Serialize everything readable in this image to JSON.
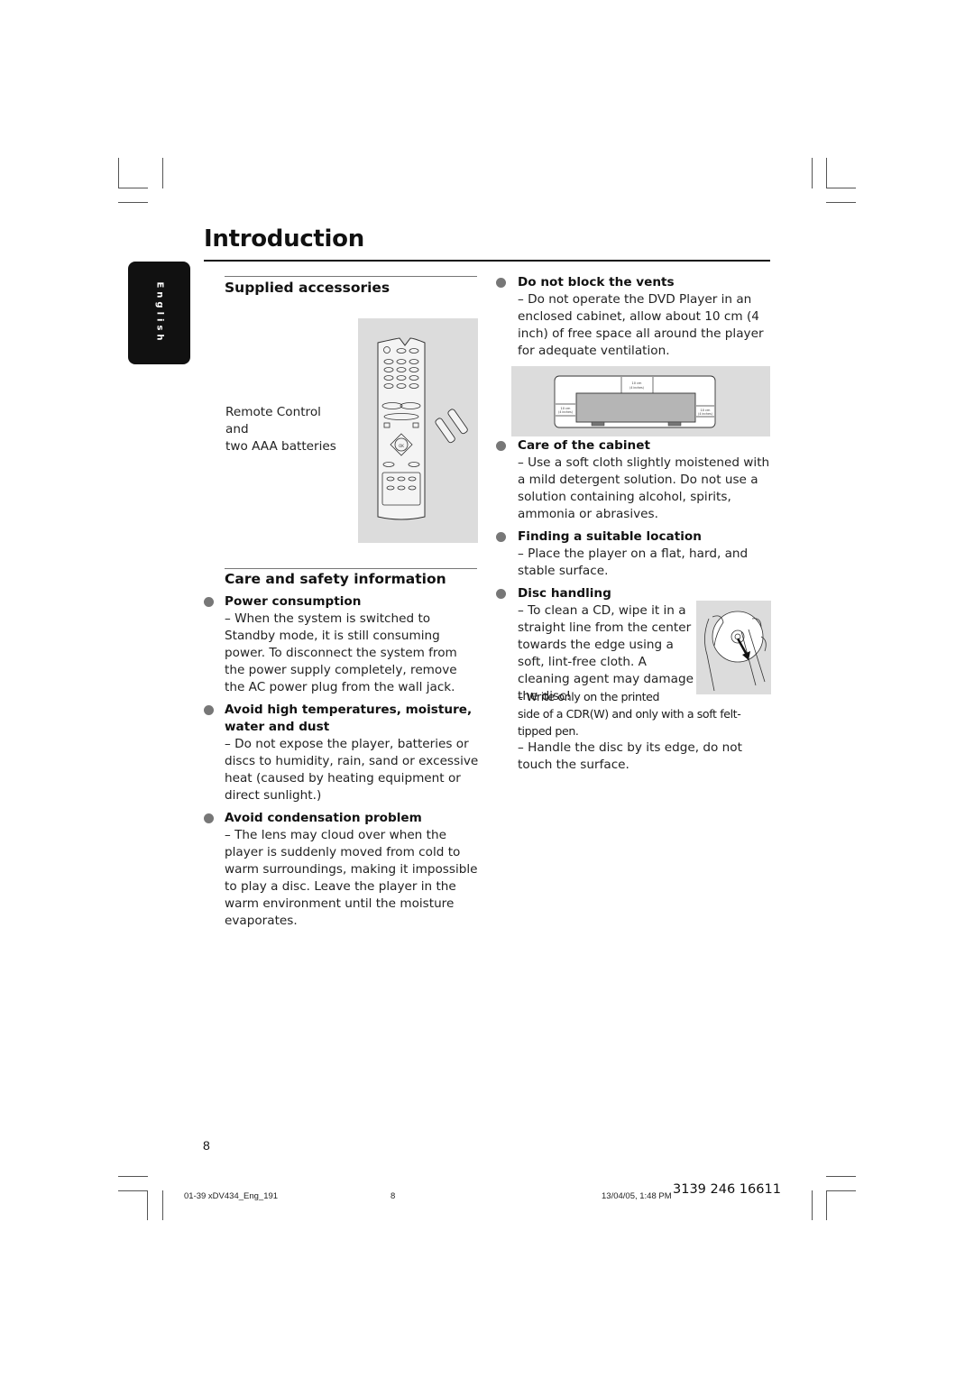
{
  "page": {
    "title": "Introduction",
    "language_tab": "English",
    "page_number": "8"
  },
  "supplied_accessories": {
    "heading": "Supplied accessories",
    "caption_lines": [
      "Remote Control",
      "and",
      "two AAA batteries"
    ],
    "image": "remote-control-and-batteries-illustration"
  },
  "care_safety": {
    "heading": "Care and safety information",
    "items": [
      {
        "title": "Power consumption",
        "text": "– When the system is switched to Standby mode, it is still consuming power. To disconnect the system from the power supply completely, remove the AC power plug from the wall jack."
      },
      {
        "title": "Avoid high temperatures, moisture, water and dust",
        "text": "– Do not expose the player, batteries or discs to humidity, rain, sand or excessive heat (caused by heating equipment or direct sunlight.)"
      },
      {
        "title": "Avoid condensation problem",
        "text": "– The lens may cloud over when the player is suddenly moved from cold to warm surroundings, making it impossible to play a disc. Leave the player in the warm environment until the moisture evaporates."
      }
    ]
  },
  "right_column": {
    "items": [
      {
        "title": "Do not block the vents",
        "text": "– Do not operate the DVD Player in an enclosed cabinet, allow about 10 cm (4 inch) of free space all around the player for adequate ventilation."
      },
      {
        "title": "Care of the cabinet",
        "text": "– Use a soft cloth slightly moistened with a mild detergent solution. Do not use a solution containing alcohol, spirits, ammonia or abrasives."
      },
      {
        "title": "Finding a suitable location",
        "text": "– Place the player on a flat, hard, and stable surface."
      },
      {
        "title": "Disc handling",
        "text_wrap": "– To clean a CD, wipe it in a straight line from the center towards the edge using a soft, lint-free cloth. A cleaning agent may damage the disc!",
        "text_write_1": "– Write only on the printed",
        "text_write_2": "side of a CDR(W) and only with a soft felt-tipped pen.",
        "text_edge": "– Handle the disc by its edge, do not touch the surface."
      }
    ],
    "vent_diagram": {
      "top_label": "10 cm",
      "top_sub": "(4 inches)",
      "left_label": "10 cm",
      "left_sub": "(4 inches)",
      "right_label": "10 cm",
      "right_sub": "(4 inches)"
    },
    "disc_image": "hand-wiping-disc-illustration"
  },
  "footer": {
    "file": "01-39 xDV434_Eng_191",
    "page": "8",
    "timestamp": "13/04/05, 1:48 PM",
    "code": "3139 246 16611"
  }
}
